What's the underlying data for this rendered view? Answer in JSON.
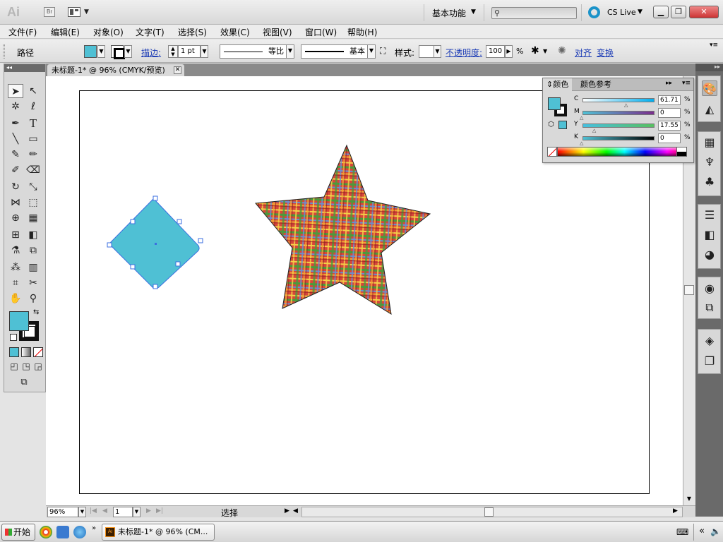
{
  "appbar": {
    "logo": "Ai",
    "bridge": "Br",
    "workspace": "基本功能",
    "cslive": "CS Live"
  },
  "menu": [
    {
      "label": "文件(F)"
    },
    {
      "label": "编辑(E)"
    },
    {
      "label": "对象(O)"
    },
    {
      "label": "文字(T)"
    },
    {
      "label": "选择(S)"
    },
    {
      "label": "效果(C)"
    },
    {
      "label": "视图(V)"
    },
    {
      "label": "窗口(W)"
    },
    {
      "label": "帮助(H)"
    }
  ],
  "control": {
    "object_type": "路径",
    "stroke_link": "描边:",
    "stroke_weight": "1 pt",
    "profile": "等比",
    "brush": "基本",
    "style_label": "样式:",
    "opacity_link": "不透明度:",
    "opacity_value": "100",
    "opacity_unit": "%",
    "align_link": "对齐",
    "transform_link": "变换"
  },
  "document": {
    "tab_title": "未标题-1* @ 96% (CMYK/预览)"
  },
  "status": {
    "zoom": "96%",
    "page": "1",
    "tool": "选择"
  },
  "color_panel": {
    "tab_color": "颜色",
    "tab_guide": "颜色参考",
    "channels": [
      {
        "label": "C",
        "value": "61.71",
        "unit": "%",
        "level": 0.6171
      },
      {
        "label": "M",
        "value": "0",
        "unit": "%",
        "level": 0
      },
      {
        "label": "Y",
        "value": "17.55",
        "unit": "%",
        "level": 0.1755
      },
      {
        "label": "K",
        "value": "0",
        "unit": "%",
        "level": 0
      }
    ]
  },
  "taskbar": {
    "start": "开始",
    "task_title": "未标题-1* @ 96% (CM..."
  },
  "colors": {
    "fill": "#4fc0d4",
    "stroke": "#000000",
    "selection": "#3b6fe0"
  },
  "artwork": {
    "shapes": [
      {
        "type": "rotated-square",
        "fill": "cyan"
      },
      {
        "type": "star",
        "fill": "plaid pattern"
      }
    ]
  }
}
